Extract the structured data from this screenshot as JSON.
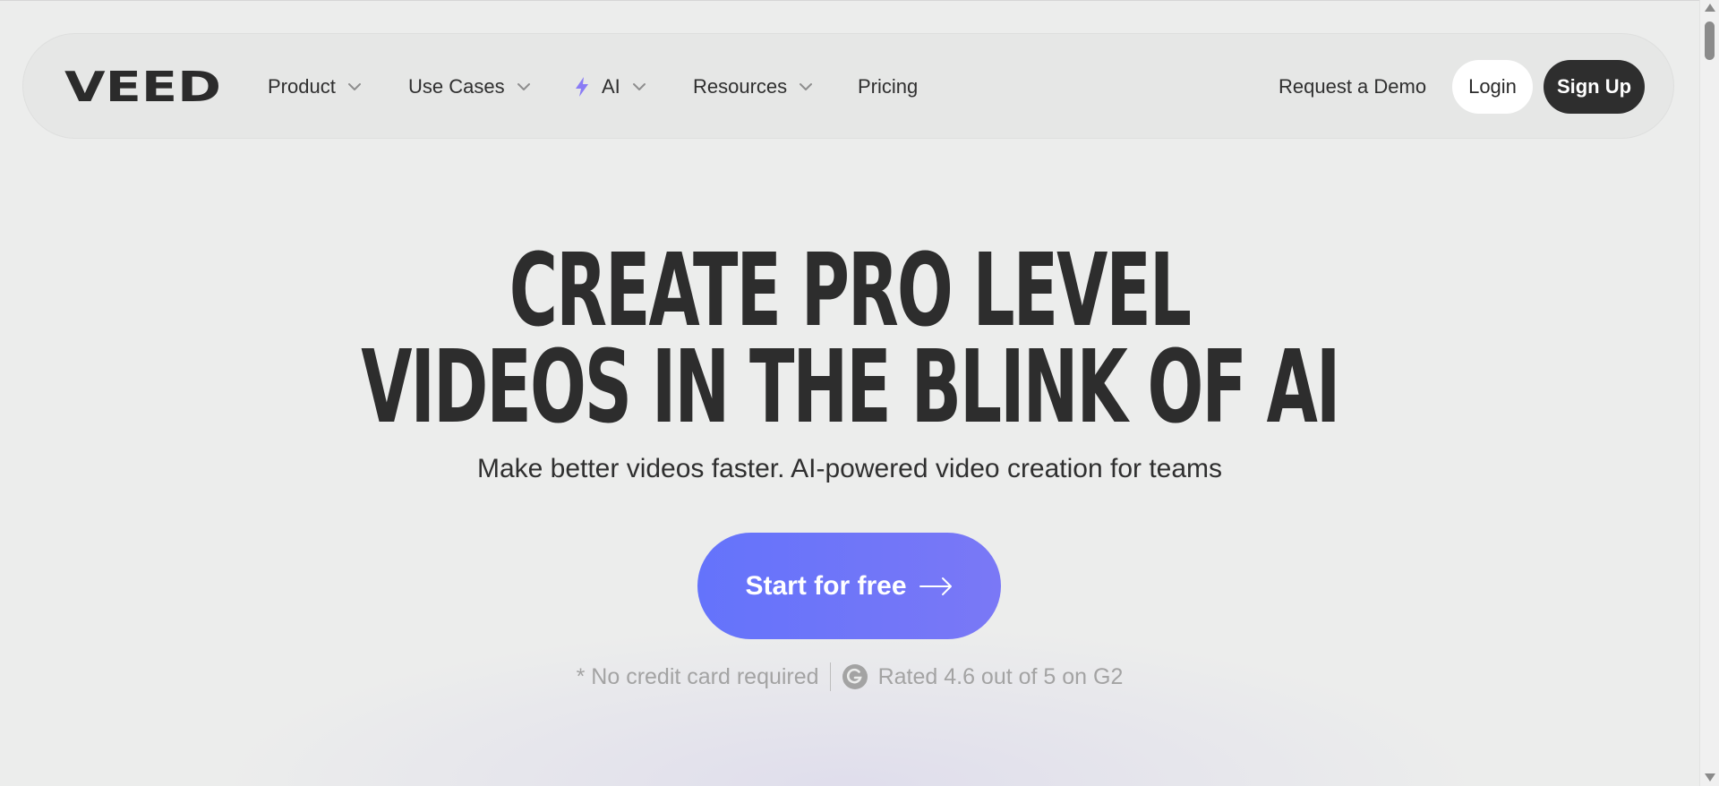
{
  "nav": {
    "logo_text": "VEED",
    "items": [
      {
        "label": "Product",
        "has_dropdown": true
      },
      {
        "label": "Use Cases",
        "has_dropdown": true
      },
      {
        "label": "AI",
        "has_dropdown": true,
        "icon": "lightning-bolt-icon"
      },
      {
        "label": "Resources",
        "has_dropdown": true
      },
      {
        "label": "Pricing",
        "has_dropdown": false
      }
    ],
    "request_demo": "Request a Demo",
    "login": "Login",
    "signup": "Sign Up"
  },
  "hero": {
    "headline_line1": "CREATE PRO LEVEL",
    "headline_line2": "VIDEOS IN THE BLINK OF AI",
    "subheadline": "Make better videos faster. AI-powered video creation for teams",
    "cta_label": "Start for free",
    "no_card_note": "* No credit card required",
    "rating_text": "Rated 4.6 out of 5 on G2"
  },
  "colors": {
    "background": "#ecedec",
    "cta_start": "#6473fb",
    "cta_end": "#7a78f6",
    "ai_bolt": "#8a7cf5",
    "dark_button": "#2e2e2e"
  }
}
